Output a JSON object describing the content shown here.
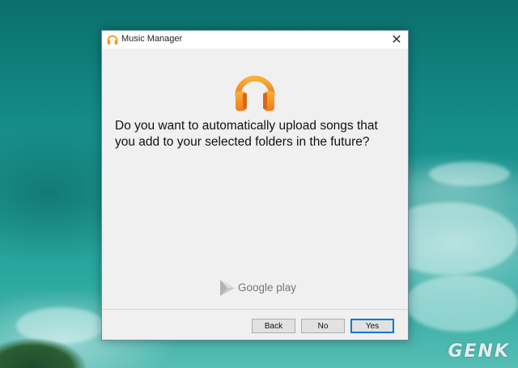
{
  "window": {
    "title": "Music Manager",
    "close_glyph": "✕",
    "icon": "headphones-icon"
  },
  "dialog": {
    "question": "Do you want to automatically upload songs that you add to your selected folders in the future?",
    "hero_icon": "headphones-icon"
  },
  "branding": {
    "text": "Google play",
    "icon": "play-triangle-icon"
  },
  "buttons": {
    "back": "Back",
    "no": "No",
    "yes": "Yes"
  },
  "watermark": "GENK",
  "colors": {
    "accent_orange": "#f5a21f",
    "default_button_border": "#0078d7"
  }
}
